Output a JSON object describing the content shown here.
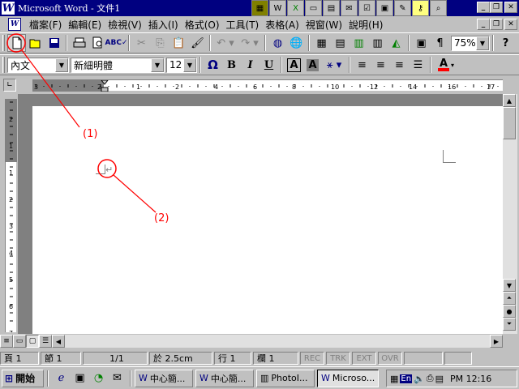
{
  "window": {
    "title": "Microsoft Word - 文件1",
    "app_logo": "W"
  },
  "office_bar": {
    "icons": [
      "office-icon",
      "word-icon",
      "excel-icon",
      "powerpoint-icon",
      "access-icon",
      "outlook-icon",
      "schedule-icon",
      "binder-icon",
      "help-icon",
      "key-icon",
      "find-icon"
    ]
  },
  "menu": {
    "items": [
      "檔案(F)",
      "編輯(E)",
      "檢視(V)",
      "插入(I)",
      "格式(O)",
      "工具(T)",
      "表格(A)",
      "視窗(W)",
      "說明(H)"
    ]
  },
  "standard_toolbar": {
    "buttons": [
      "new-document",
      "open",
      "save",
      "print",
      "print-preview",
      "spelling",
      "cut",
      "copy",
      "paste",
      "format-painter",
      "undo",
      "redo",
      "web-toolbar",
      "hyperlink",
      "tables-borders",
      "insert-table",
      "insert-excel",
      "columns",
      "drawing",
      "document-map",
      "show-hide",
      "zoom"
    ],
    "zoom": "75%",
    "help_icon": "?"
  },
  "format_toolbar": {
    "style": "內文",
    "font": "新細明體",
    "size": "12",
    "symbol": "Ω",
    "bold": "B",
    "italic": "I",
    "underline": "U",
    "a1": "A",
    "a2": "A",
    "font_color_label": "A"
  },
  "ruler": {
    "h_numbers": [
      "3",
      "2",
      "1",
      "2",
      "4",
      "6",
      "8",
      "10",
      "12",
      "14",
      "16",
      "17"
    ],
    "v_numbers": [
      "2",
      "1",
      "1",
      "2",
      "3",
      "4",
      "5",
      "6",
      "7"
    ]
  },
  "document": {
    "paragraph_mark": "↵"
  },
  "annotations": {
    "label1": "(1)",
    "label2": "(2)"
  },
  "status": {
    "page": "頁 1",
    "section": "節 1",
    "page_of": "1/1",
    "at": "於 2.5cm",
    "line": "行 1",
    "col": "欄 1",
    "rec": "REC",
    "trk": "TRK",
    "ext": "EXT",
    "ovr": "OVR"
  },
  "taskbar": {
    "start": "開始",
    "tasks": [
      "中心簡...",
      "中心簡...",
      "PhotoI...",
      "Microso..."
    ],
    "clock": "PM 12:16",
    "lang": "En"
  },
  "colors": {
    "title_bg": "#000080",
    "annotation": "#ff0000",
    "font_color_bar": "#ff0000"
  }
}
